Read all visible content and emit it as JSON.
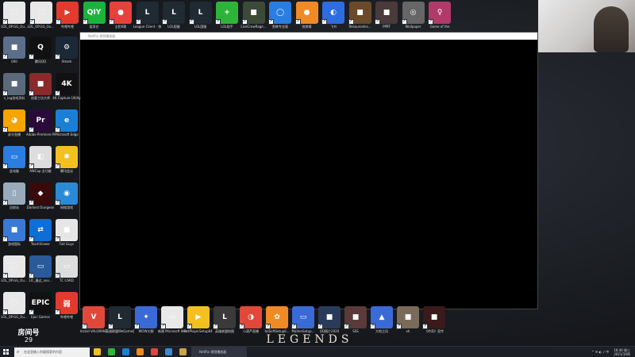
{
  "colors": {
    "desktop": "#1a1d22",
    "player_bg": "#000000",
    "taskbar": "#1c1f26"
  },
  "desktop_icons_top": [
    {
      "label": "LOL_OP.GG_Ou...",
      "color": "#e8e8e8",
      "glyph": "⬚"
    },
    {
      "label": "LOL_OP.GG_Ou...",
      "color": "#e8e8e8",
      "glyph": "⬚"
    },
    {
      "label": "哔哩哔哩",
      "color": "#e23b2e",
      "glyph": "▶"
    },
    {
      "label": "爱奇艺",
      "color": "#1ab43c",
      "glyph": "QIY"
    },
    {
      "label": "全民K歌",
      "color": "#e8413c",
      "glyph": "●"
    },
    {
      "label": "League Client - 快",
      "color": "#1f2a33",
      "glyph": "L"
    },
    {
      "label": "LOL国服",
      "color": "#1f2a33",
      "glyph": "L"
    },
    {
      "label": "LOL国服",
      "color": "#1f2a33",
      "glyph": "L"
    },
    {
      "label": "LOL助手",
      "color": "#2fb43a",
      "glyph": "+"
    },
    {
      "label": "LiveCrowRage...",
      "color": "#3c4a3a",
      "glyph": "■"
    },
    {
      "label": "剪映专业版",
      "color": "#2a7de1",
      "glyph": "◯"
    },
    {
      "label": "快剪辑",
      "color": "#f08a24",
      "glyph": "●"
    },
    {
      "label": "飞书",
      "color": "#2d6de1",
      "glyph": "◐"
    },
    {
      "label": "ResourceIns...",
      "color": "#6a4a2a",
      "glyph": "■"
    },
    {
      "label": "PPRT",
      "color": "#4a3a3a",
      "glyph": "■"
    },
    {
      "label": "Wallpaper",
      "color": "#666",
      "glyph": "◎"
    },
    {
      "label": "Game of the",
      "color": "#b13a6a",
      "glyph": "♀"
    }
  ],
  "desktop_icons_left": [
    {
      "label": "000",
      "color": "#5c6f8a",
      "glyph": "■"
    },
    {
      "label": "腾讯QQ",
      "color": "#111",
      "glyph": "Q"
    },
    {
      "label": "Steam",
      "color": "#1b2838",
      "glyph": "⚙"
    },
    {
      "label": "n_log游戏资料",
      "color": "#5a6a7a",
      "glyph": "■"
    },
    {
      "label": "创意工坊大师",
      "color": "#8a2a2a",
      "glyph": "■"
    },
    {
      "label": "4K Capture Utility",
      "color": "#111",
      "glyph": "4K"
    },
    {
      "label": "虎牙直播",
      "color": "#f5a400",
      "glyph": "◕"
    },
    {
      "label": "Adobe Premiere Pro",
      "color": "#2a0a3a",
      "glyph": "Pr"
    },
    {
      "label": "Microsoft Edge",
      "color": "#1b7fd6",
      "glyph": "e"
    },
    {
      "label": "此电脑",
      "color": "#2a7de1",
      "glyph": "▭"
    },
    {
      "label": "AWCap 全功能",
      "color": "#ddd",
      "glyph": "◧"
    },
    {
      "label": "腾讯会议",
      "color": "#f4c020",
      "glyph": "✱"
    },
    {
      "label": "回收站",
      "color": "#9ab",
      "glyph": "▯"
    },
    {
      "label": "Darkest Dungeon",
      "color": "#3a0a0a",
      "glyph": "◆"
    },
    {
      "label": "网络游戏",
      "color": "#2a8ad6",
      "glyph": "◉"
    },
    {
      "label": "游戏图标",
      "color": "#3a7ad6",
      "glyph": "■"
    },
    {
      "label": "TeamViewer",
      "color": "#0d6ed6",
      "glyph": "⇄"
    },
    {
      "label": "Fall Guys",
      "color": "#e6e6e6",
      "glyph": "■"
    },
    {
      "label": "LOL_OP.GG_Ou...",
      "color": "#e8e8e8",
      "glyph": "⬚"
    },
    {
      "label": "LIC_最近_xxx...",
      "color": "#2a5a9a",
      "glyph": "▭"
    },
    {
      "label": "TC CARD",
      "color": "#ddd",
      "glyph": "▭"
    },
    {
      "label": "LOL_OP.GG_Ou...",
      "color": "#e8e8e8",
      "glyph": "⬚"
    },
    {
      "label": "Epic Games",
      "color": "#111",
      "glyph": "EPIC"
    },
    {
      "label": "哔哩哔哩",
      "color": "#e23b2e",
      "glyph": "弱"
    }
  ],
  "desktop_icons_bottom": [
    {
      "label": "Install VALORANT",
      "color": "#e2483a",
      "glyph": "V"
    },
    {
      "label": "英雄联盟WeGame版",
      "color": "#1f2a33",
      "glyph": "L"
    },
    {
      "label": "WOW大脚",
      "color": "#3a6ad6",
      "glyph": "✦"
    },
    {
      "label": "新建 Microsoft Word 文档",
      "color": "#e8e8e8",
      "glyph": "▭"
    },
    {
      "label": "PotPlayerSetup64",
      "color": "#f4c020",
      "glyph": "▶"
    },
    {
      "label": "英雄联盟地图",
      "color": "#3a3a3a",
      "glyph": "L"
    },
    {
      "label": "小葫芦直播",
      "color": "#e2483a",
      "glyph": "◑"
    },
    {
      "label": "taiSoftSetup6...",
      "color": "#f08a24",
      "glyph": "✿"
    },
    {
      "label": "MaitenSetup...",
      "color": "#3a6ad6",
      "glyph": "▭"
    },
    {
      "label": "QQ图片2020",
      "color": "#2a3a5a",
      "glyph": "■"
    },
    {
      "label": "SSS",
      "color": "#5a3a3a",
      "glyph": "■"
    },
    {
      "label": "大地之风",
      "color": "#3a6ad6",
      "glyph": "▲"
    },
    {
      "label": "xh",
      "color": "#7a6a5a",
      "glyph": "■"
    },
    {
      "label": "《传奇》宣传",
      "color": "#3a1a1a",
      "glyph": "■"
    }
  ],
  "player": {
    "title": "Netflix 视频播放器"
  },
  "stream_overlay": {
    "banner": "LEGENDS",
    "room_label": "房间号",
    "room_number": "29"
  },
  "taskbar": {
    "search_placeholder": "在这里输入你要搜索的内容",
    "active_window_title": "Netflix 视频播放器",
    "apps": [
      {
        "name": "file-explorer",
        "color": "#f4c020"
      },
      {
        "name": "chrome",
        "color": "#2fb43a"
      },
      {
        "name": "edge",
        "color": "#1b7fd6"
      },
      {
        "name": "qq",
        "color": "#f08a24"
      },
      {
        "name": "wegame",
        "color": "#e2483a"
      },
      {
        "name": "media-player",
        "color": "#3a8ad6"
      },
      {
        "name": "league",
        "color": "#c9a64a"
      }
    ],
    "tray_text": "^ ✉ ◐ ♪ 中",
    "time": "16:40 周三",
    "date": "2021/10/8"
  }
}
